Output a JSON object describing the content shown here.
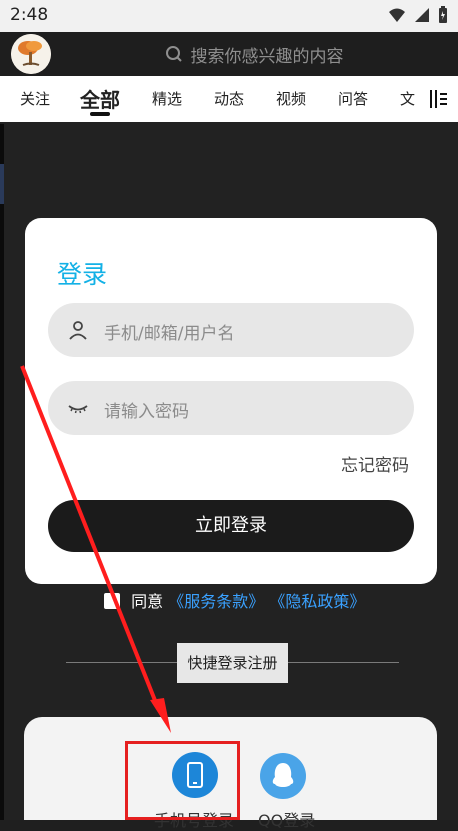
{
  "status_bar": {
    "time": "2:48"
  },
  "header": {
    "search_placeholder": "搜索你感兴趣的内容"
  },
  "tabs": [
    "关注",
    "全部",
    "精选",
    "动态",
    "视频",
    "问答",
    "文"
  ],
  "login": {
    "title": "登录",
    "username_placeholder": "手机/邮箱/用户名",
    "password_placeholder": "请输入密码",
    "forgot": "忘记密码",
    "submit": "立即登录"
  },
  "agreement": {
    "agree_text": "同意",
    "terms": "《服务条款》",
    "privacy": "《隐私政策》"
  },
  "quick": {
    "label": "快捷登录注册"
  },
  "bottom_options": {
    "phone_label": "手机号登录",
    "qq_label": "QQ登录"
  },
  "colors": {
    "accent_blue": "#13b1e6",
    "link_blue": "#3aa1ff",
    "highlight_red": "#e51f1f"
  }
}
